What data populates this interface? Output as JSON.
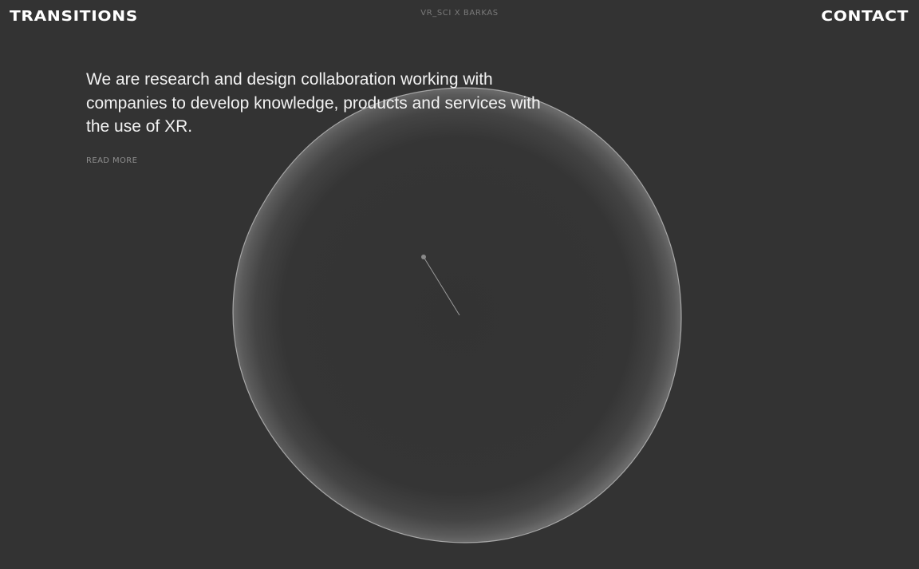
{
  "header": {
    "logo": "TRANSITIONS",
    "center_title": "VR_SCI X BARKAS",
    "contact": "CONTACT"
  },
  "intro": {
    "text": "We are research and design collaboration working with companies to develop knowledge,  products and services with the use of XR.",
    "read_more": "READ MORE"
  },
  "colors": {
    "background": "#333333",
    "text": "#ffffff",
    "muted": "#7a7a7a",
    "sphere_edge": "#bdbdbd"
  }
}
